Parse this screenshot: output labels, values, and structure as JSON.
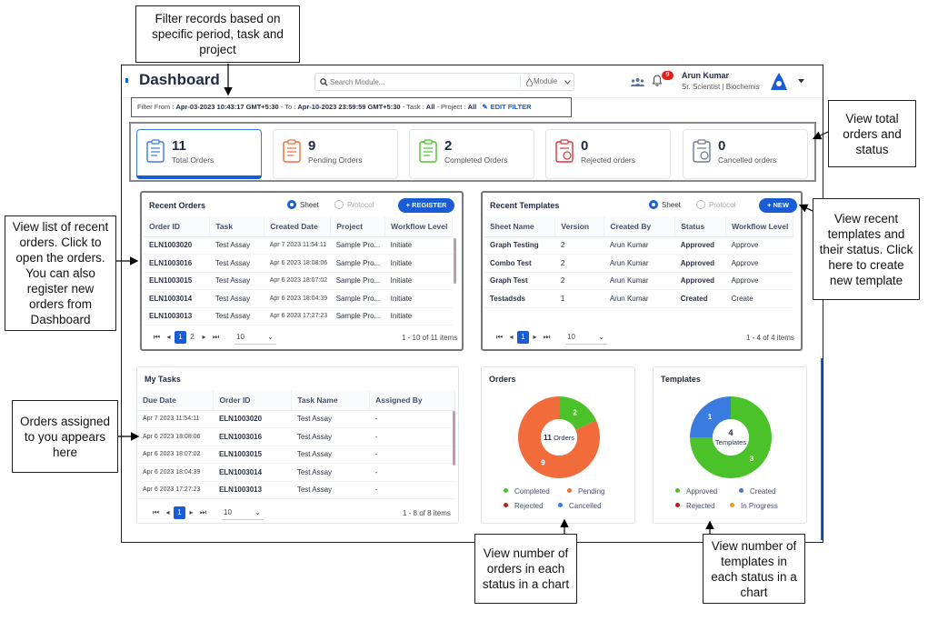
{
  "callouts": {
    "filter": "Filter records based  on specific period, task and project",
    "total_orders": "View total orders and status",
    "recent_templates": "View recent templates and their status. Click here to create new template",
    "recent_orders": "View list of recent orders. Click to open the orders. You can also register new orders from Dashboard",
    "tasks": "Orders assigned to you appears here",
    "orders_chart": "View number of orders in each status in a chart",
    "templates_chart": "View number of templates in each status in a chart"
  },
  "header": {
    "title": "Dashboard",
    "search_placeholder": "Search Module...",
    "module_label": "Module",
    "notification_count": "9",
    "user_name": "Arun Kumar",
    "user_role": "Sr. Scientist | Biochemis"
  },
  "filter": {
    "prefix": "Filter From : ",
    "from": "Apr-03-2023 10:43:17 GMT+5:30",
    "to_label": " - To : ",
    "to": "Apr-10-2023 23:59:59 GMT+5:30",
    "task_label": " - Task : ",
    "task": "All",
    "project_label": " - Project : ",
    "project": "All",
    "edit_label": "EDIT FILTER"
  },
  "stats": [
    {
      "count": "11",
      "label": "Total Orders",
      "color": "#3a7be0"
    },
    {
      "count": "9",
      "label": "Pending Orders",
      "color": "#f26b3a"
    },
    {
      "count": "2",
      "label": "Completed Orders",
      "color": "#4cc22a"
    },
    {
      "count": "0",
      "label": "Rejected orders",
      "color": "#d9363e"
    },
    {
      "count": "0",
      "label": "Cancelled orders",
      "color": "#6b7a90"
    }
  ],
  "recent_orders": {
    "title": "Recent Orders",
    "radio_sheet": "Sheet",
    "radio_protocol": "Protocol",
    "register_label": "REGISTER",
    "columns": [
      "Order ID",
      "Task",
      "Created Date",
      "Project",
      "Workflow Level"
    ],
    "rows": [
      [
        "ELN1003020",
        "Test Assay",
        "Apr 7 2023 11:54:11",
        "Sample Pro...",
        "Initiate"
      ],
      [
        "ELN1003016",
        "Test Assay",
        "Apr 6 2023 18:08:06",
        "Sample Pro...",
        "Initiate"
      ],
      [
        "ELN1003015",
        "Test Assay",
        "Apr 6 2023 18:07:02",
        "Sample Pro...",
        "Initiate"
      ],
      [
        "ELN1003014",
        "Test Assay",
        "Apr 6 2023 18:04:39",
        "Sample Pro...",
        "Initiate"
      ],
      [
        "ELN1003013",
        "Test Assay",
        "Apr 6 2023 17:27:23",
        "Sample Pro...",
        "Initiate"
      ]
    ],
    "pages": [
      "1",
      "2"
    ],
    "page_size": "10",
    "info": "1 - 10 of 11 items"
  },
  "recent_templates": {
    "title": "Recent Templates",
    "radio_sheet": "Sheet",
    "radio_protocol": "Protocol",
    "new_label": "NEW",
    "columns": [
      "Sheet Name",
      "Version",
      "Created By",
      "Status",
      "Workflow Level"
    ],
    "rows": [
      [
        "Graph Testing",
        "2",
        "Arun Kumar",
        "Approved",
        "Approve"
      ],
      [
        "Combo Test",
        "2",
        "Arun Kumar",
        "Approved",
        "Approve"
      ],
      [
        "Graph Test",
        "2",
        "Arun Kumar",
        "Approved",
        "Approve"
      ],
      [
        "Testadsds",
        "1",
        "Arun Kumar",
        "Created",
        "Create"
      ]
    ],
    "pages": [
      "1"
    ],
    "page_size": "10",
    "info": "1 - 4 of 4 items"
  },
  "my_tasks": {
    "title": "My Tasks",
    "columns": [
      "Due Date",
      "Order ID",
      "Task Name",
      "Assigned By"
    ],
    "rows": [
      [
        "Apr 7 2023 11:54:11",
        "ELN1003020",
        "Test Assay",
        "-"
      ],
      [
        "Apr 6 2023 18:08:06",
        "ELN1003016",
        "Test Assay",
        "-"
      ],
      [
        "Apr 6 2023 18:07:02",
        "ELN1003015",
        "Test Assay",
        "-"
      ],
      [
        "Apr 6 2023 18:04:39",
        "ELN1003014",
        "Test Assay",
        "-"
      ],
      [
        "Apr 6 2023 17:27:23",
        "ELN1003013",
        "Test Assay",
        "-"
      ]
    ],
    "pages": [
      "1"
    ],
    "page_size": "10",
    "info": "1 - 8 of 8 items"
  },
  "chart_data": [
    {
      "type": "pie",
      "title": "Orders",
      "center_label": "Orders",
      "center_value": "11",
      "categories": [
        "Completed",
        "Pending",
        "Rejected",
        "Cancelled"
      ],
      "values": [
        2,
        9,
        0,
        0
      ],
      "colors": [
        "#4cc22a",
        "#f26b3a",
        "#b52020",
        "#3a7be0"
      ]
    },
    {
      "type": "pie",
      "title": "Templates",
      "center_label": "Templates",
      "center_value": "4",
      "categories": [
        "Approved",
        "Created",
        "Rejected",
        "In Progress"
      ],
      "values": [
        3,
        1,
        0,
        0
      ],
      "colors": [
        "#4cc22a",
        "#3a7be0",
        "#b52020",
        "#f29a1a"
      ]
    }
  ]
}
